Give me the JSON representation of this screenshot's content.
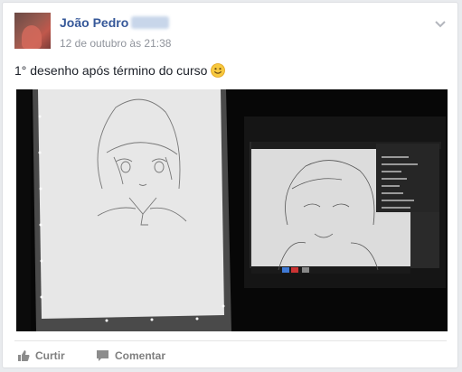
{
  "post": {
    "author": "João Pedro",
    "timestamp": "12 de outubro às 21:38",
    "text": "1° desenho após término do curso"
  },
  "actions": {
    "like_label": "Curtir",
    "comment_label": "Comentar"
  },
  "icons": {
    "options": "chevron-down-icon",
    "emoji": "smiley-emoji-icon",
    "like": "thumbs-up-icon",
    "comment": "speech-bubble-icon"
  },
  "colors": {
    "author_link": "#365899",
    "meta_text": "#90949c",
    "body_text": "#1d2129",
    "action_text": "#7f7f7f"
  }
}
